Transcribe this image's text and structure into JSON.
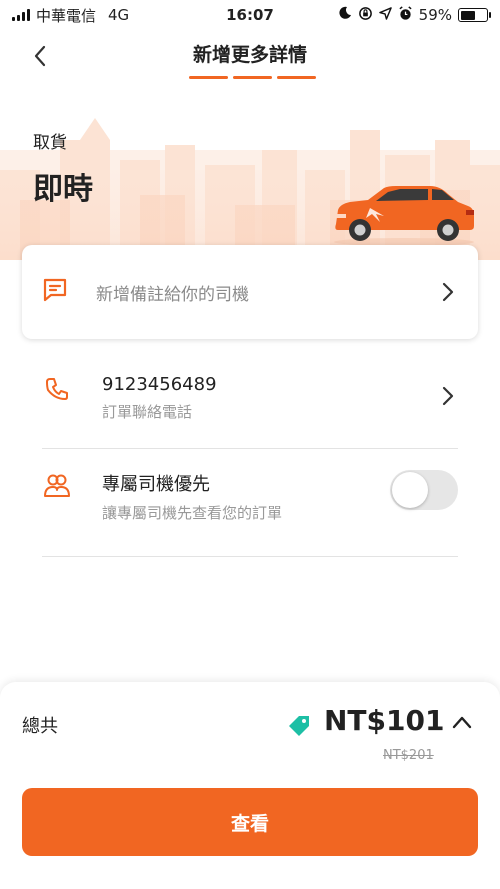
{
  "status_bar": {
    "carrier": "中華電信",
    "network": "4G",
    "time": "16:07",
    "battery": "59%",
    "battery_level": 0.59
  },
  "header": {
    "title": "新增更多詳情",
    "progress_steps": 3
  },
  "pickup": {
    "label": "取貨",
    "time": "即時"
  },
  "note_card": {
    "label": "新增備註給你的司機"
  },
  "phone_row": {
    "title": "9123456489",
    "subtitle": "訂單聯絡電話"
  },
  "priority_row": {
    "title": "專屬司機優先",
    "subtitle": "讓專屬司機先查看您的訂單",
    "toggle_on": false
  },
  "summary": {
    "total_label": "總共",
    "price": "NT$101",
    "original_price": "NT$201"
  },
  "cta": {
    "label": "查看"
  },
  "colors": {
    "accent": "#f16622",
    "tag": "#1dbfa5"
  }
}
